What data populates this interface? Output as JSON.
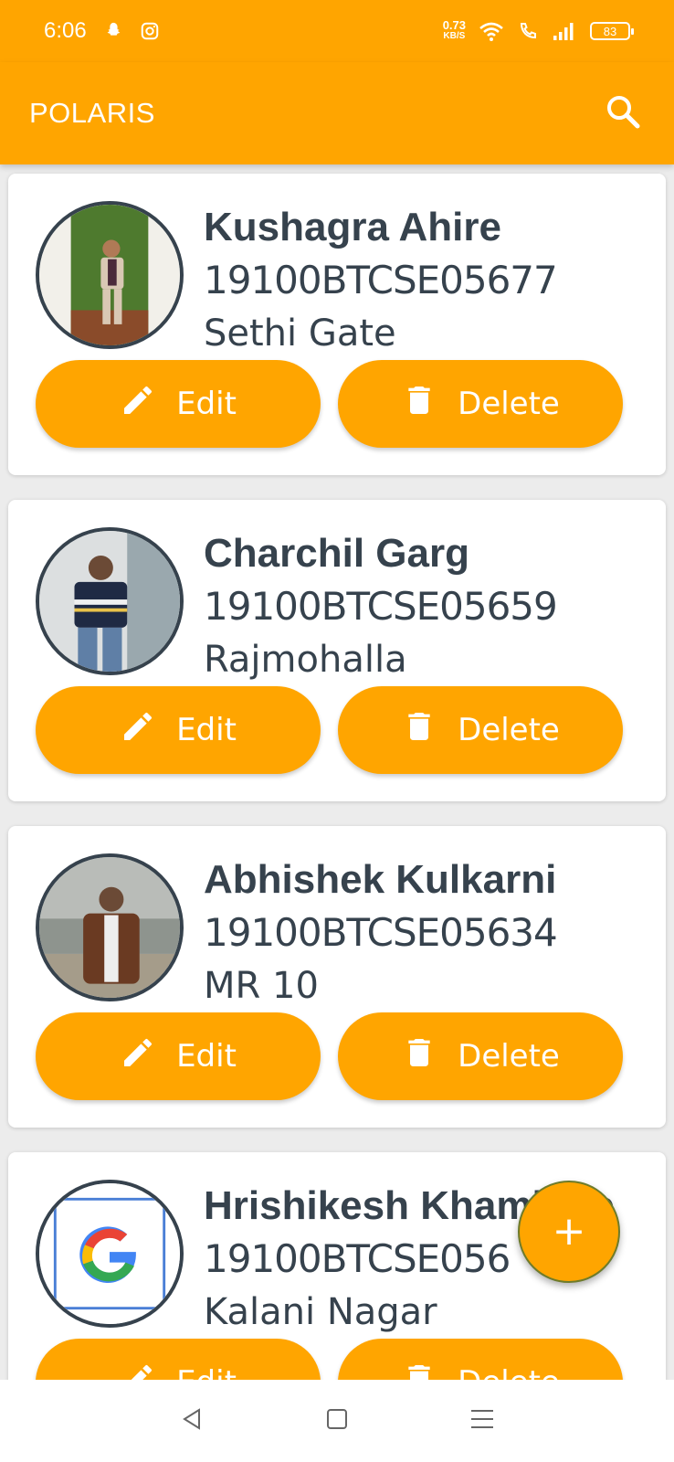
{
  "status_bar": {
    "time": "6:06",
    "net_speed_value": "0.73",
    "net_speed_unit": "KB/S",
    "battery": "83"
  },
  "app_bar": {
    "title": "POLARIS"
  },
  "students": [
    {
      "name": "Kushagra Ahire",
      "roll": "19100BTCSE05677",
      "address": "Sethi Gate",
      "edit_label": "Edit",
      "delete_label": "Delete"
    },
    {
      "name": "Charchil Garg",
      "roll": "19100BTCSE05659",
      "address": "Rajmohalla",
      "edit_label": "Edit",
      "delete_label": "Delete"
    },
    {
      "name": "Abhishek Kulkarni",
      "roll": "19100BTCSE05634",
      "address": "MR 10",
      "edit_label": "Edit",
      "delete_label": "Delete"
    },
    {
      "name": "Hrishikesh Khambete",
      "roll": "19100BTCSE056",
      "address": "Kalani Nagar",
      "edit_label": "Edit",
      "delete_label": "Delete"
    }
  ],
  "fab": {
    "label": "+"
  },
  "icons": {
    "search": "search-icon",
    "edit": "pencil-icon",
    "delete": "trash-icon",
    "nav_back": "back-triangle-icon",
    "nav_home": "home-square-icon",
    "nav_menu": "menu-lines-icon"
  },
  "colors": {
    "accent": "#FFA500",
    "text": "#36424d",
    "background": "#ececec"
  }
}
